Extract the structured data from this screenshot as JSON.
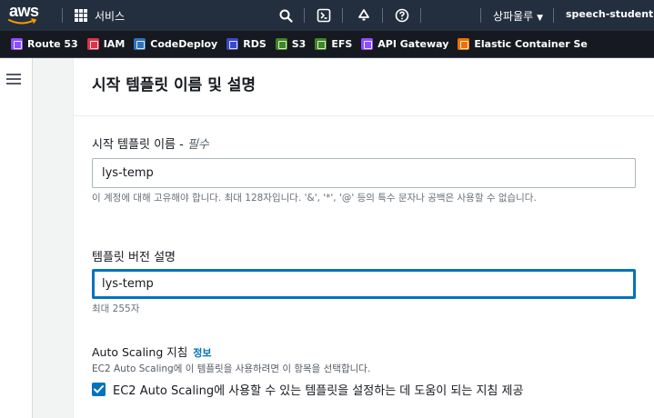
{
  "topnav": {
    "logo_text": "aws",
    "services_label": "서비스",
    "region_label": "상파울루",
    "user_label": "speech-student @"
  },
  "favorites": [
    {
      "label": "Route 53",
      "color": "#8c4fff"
    },
    {
      "label": "IAM",
      "color": "#dd344c"
    },
    {
      "label": "CodeDeploy",
      "color": "#2e73b8"
    },
    {
      "label": "RDS",
      "color": "#3b48cc"
    },
    {
      "label": "S3",
      "color": "#3f8624"
    },
    {
      "label": "EFS",
      "color": "#3f8624"
    },
    {
      "label": "API Gateway",
      "color": "#8c4fff"
    },
    {
      "label": "Elastic Container Se",
      "color": "#ed7100"
    }
  ],
  "panel": {
    "title": "시작 템플릿 이름 및 설명",
    "name_label": "시작 템플릿 이름 - ",
    "name_required": "필수",
    "name_value": "lys-temp",
    "name_hint": "이 계정에 대해 고유해야 합니다. 최대 128자입니다. '&', '*', '@' 등의 특수 문자나 공백은 사용할 수 없습니다.",
    "desc_label": "템플릿 버전 설명",
    "desc_value": "lys-temp",
    "desc_hint": "최대 255자",
    "guidance_label": "Auto Scaling 지침",
    "guidance_info": "정보",
    "guidance_desc": "EC2 Auto Scaling에 이 템플릿을 사용하려면 이 항목을 선택합니다.",
    "guidance_checkbox_label": "EC2 Auto Scaling에 사용할 수 있는 템플릿을 설정하는 데 도움이 되는 지침 제공",
    "guidance_checked": true
  },
  "colors": {
    "nav_bg": "#232f3e",
    "fav_bg": "#16191f",
    "accent": "#0073bb"
  }
}
